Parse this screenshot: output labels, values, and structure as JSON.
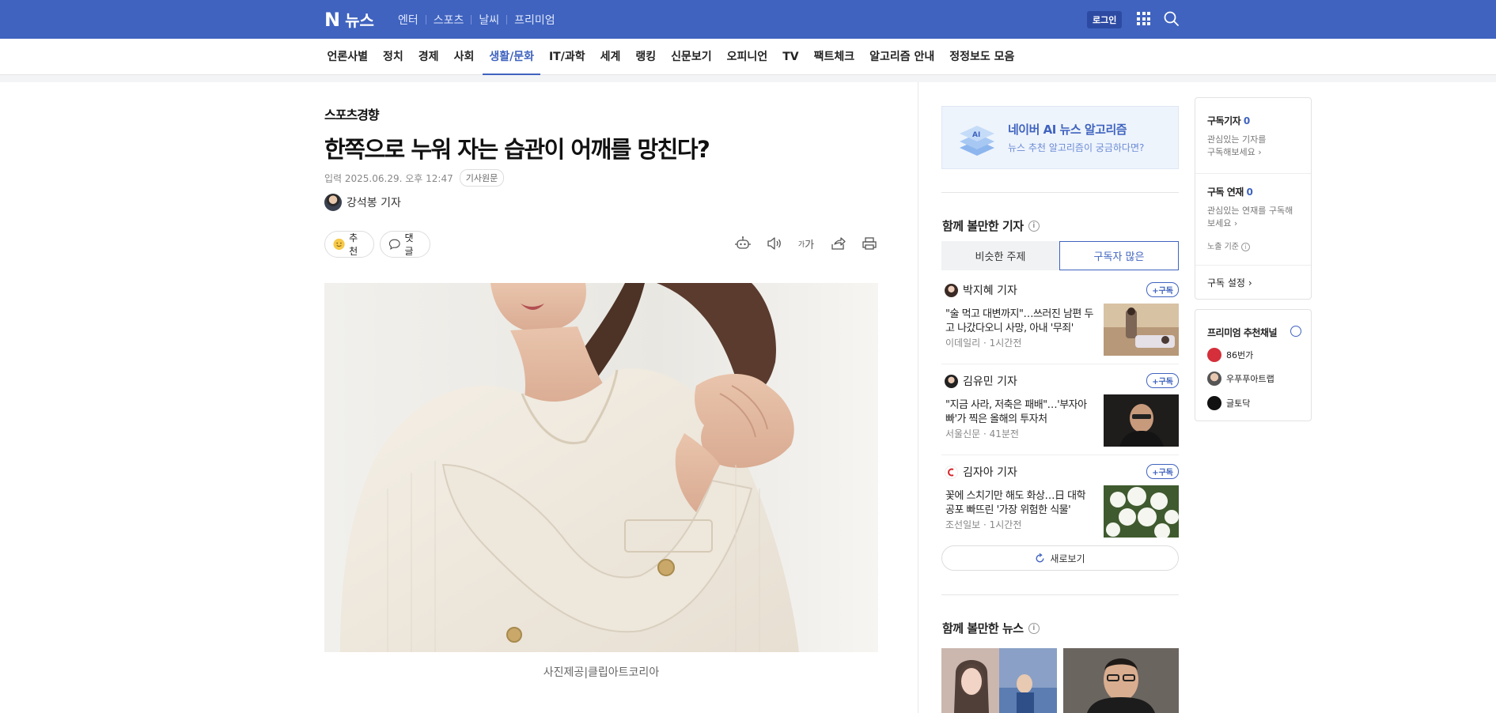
{
  "topbar": {
    "logo_mark": "N",
    "logo_text": "뉴스",
    "links": [
      "엔터",
      "스포츠",
      "날씨",
      "프리미엄"
    ],
    "login_label": "로그인",
    "brand_color": "#3f63bf"
  },
  "categories": [
    "언론사별",
    "정치",
    "경제",
    "사회",
    "생활/문화",
    "IT/과학",
    "세계",
    "랭킹",
    "신문보기",
    "오피니언",
    "TV",
    "팩트체크",
    "알고리즘 안내",
    "정정보도 모음"
  ],
  "active_category": "생활/문화",
  "article": {
    "press": "스포츠경향",
    "headline": "한쪽으로 누워 자는 습관이 어깨를 망친다?",
    "dateline": "입력 2025.06.29. 오후 12:47",
    "origin_label": "기사원문",
    "reporter": "강석봉 기자",
    "recommend_label": "추천",
    "comment_label": "댓글",
    "font_tool_label": "가",
    "caption": "사진제공|클립아트코리아"
  },
  "ai_banner": {
    "title": "네이버 AI 뉴스 알고리즘",
    "subtitle": "뉴스 추천 알고리즘이 궁금하다면?"
  },
  "recommend_section": {
    "title": "함께 볼만한 기자",
    "tabs": [
      "비슷한 주제",
      "구독자 많은"
    ],
    "active_tab": "구독자 많은",
    "subscribe_label": "+구독",
    "items": [
      {
        "reporter": "박지혜 기자",
        "title": "\"술 먹고 대변까지\"…쓰러진 남편 두고 나갔다오니 사망, 아내 '무죄'",
        "press": "이데일리",
        "time": "1시간전"
      },
      {
        "reporter": "김유민 기자",
        "title": "\"지금 사라, 저축은 패배\"…'부자아빠'가 찍은 올해의 투자처",
        "press": "서울신문",
        "time": "41분전"
      },
      {
        "reporter": "김자아 기자",
        "title": "꽃에 스치기만 해도 화상…日 대학 공포 빠뜨린 '가장 위험한 식물'",
        "press": "조선일보",
        "time": "1시간전"
      }
    ],
    "refresh_label": "새로보기"
  },
  "news_section": {
    "title": "함께 볼만한 뉴스"
  },
  "subscription_panel": {
    "reporter_title": "구독기자",
    "reporter_count": "0",
    "reporter_desc_1": "관심있는 기자를",
    "reporter_desc_2": "구독해보세요",
    "series_title": "구독 연재",
    "series_count": "0",
    "series_desc_1": "관심있는 연재를 구독해",
    "series_desc_2": "보세요",
    "exposure_label": "노출 기준",
    "settings_label": "구독 설정"
  },
  "premium_panel": {
    "title": "프리미엄 추천채널",
    "channels": [
      "86번가",
      "우푸푸아트랩",
      "글토닥"
    ]
  }
}
